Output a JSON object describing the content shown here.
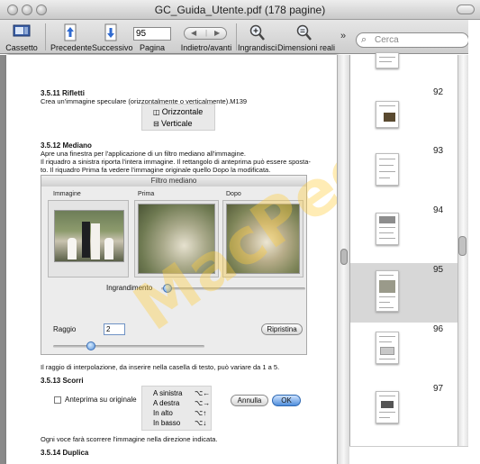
{
  "window": {
    "title": "GC_Guida_Utente.pdf (178 pagine)"
  },
  "toolbar": {
    "drawer_label": "Cassetto",
    "prev_label": "Precedente",
    "next_label": "Successivo",
    "page_value": "95",
    "page_label": "Pagina",
    "backforward_label": "Indietro/avanti",
    "zoom_in_label": "Ingrandisci",
    "actual_size_label": "Dimensioni reali",
    "overflow_glyph": "»",
    "search_placeholder": "Cerca"
  },
  "sidebar": {
    "pages": [
      "92",
      "93",
      "94",
      "95",
      "96",
      "97"
    ],
    "selected": "95"
  },
  "doc": {
    "s1_heading": "3.5.11 Rifletti",
    "s1_text": "Crea un'immagine speculare (orizzontalmente o verticalmente).M139",
    "reflect_h": "Orizzontale",
    "reflect_v": "Verticale",
    "s2_heading": "3.5.12 Mediano",
    "s2_line1": "Apre una finestra per l'applicazione di un filtro mediano all'immagine.",
    "s2_line2": "Il riquadro a sinistra riporta l'intera immagine. Il rettangolo di anteprima può essere sposta-",
    "s2_line3": "to. Il riquadro Prima fa vedere l'immagine originale quello Dopo la modificata.",
    "dialog": {
      "title": "Filtro mediano",
      "col1": "Immagine",
      "col2": "Prima",
      "col3": "Dopo",
      "zoom_label": "Ingrandimento",
      "radius_label": "Raggio",
      "radius_value": "2",
      "reset_button": "Ripristina",
      "preview_checkbox": "Anteprima su originale",
      "cancel_button": "Annulla",
      "ok_button": "OK"
    },
    "s2_after": "Il raggio di interpolazione, da inserire nella casella di testo, può variare da 1 a 5.",
    "s3_heading": "3.5.13 Scorri",
    "scroll_items": [
      {
        "label": "A sinistra",
        "key": "⌥←"
      },
      {
        "label": "A destra",
        "key": "⌥→"
      },
      {
        "label": "In alto",
        "key": "⌥↑"
      },
      {
        "label": "In basso",
        "key": "⌥↓"
      }
    ],
    "s3_text": "Ogni voce farà scorrere l'immagine nella direzione indicata.",
    "s4_heading": "3.5.14 Duplica",
    "watermark": "MacPeer"
  }
}
